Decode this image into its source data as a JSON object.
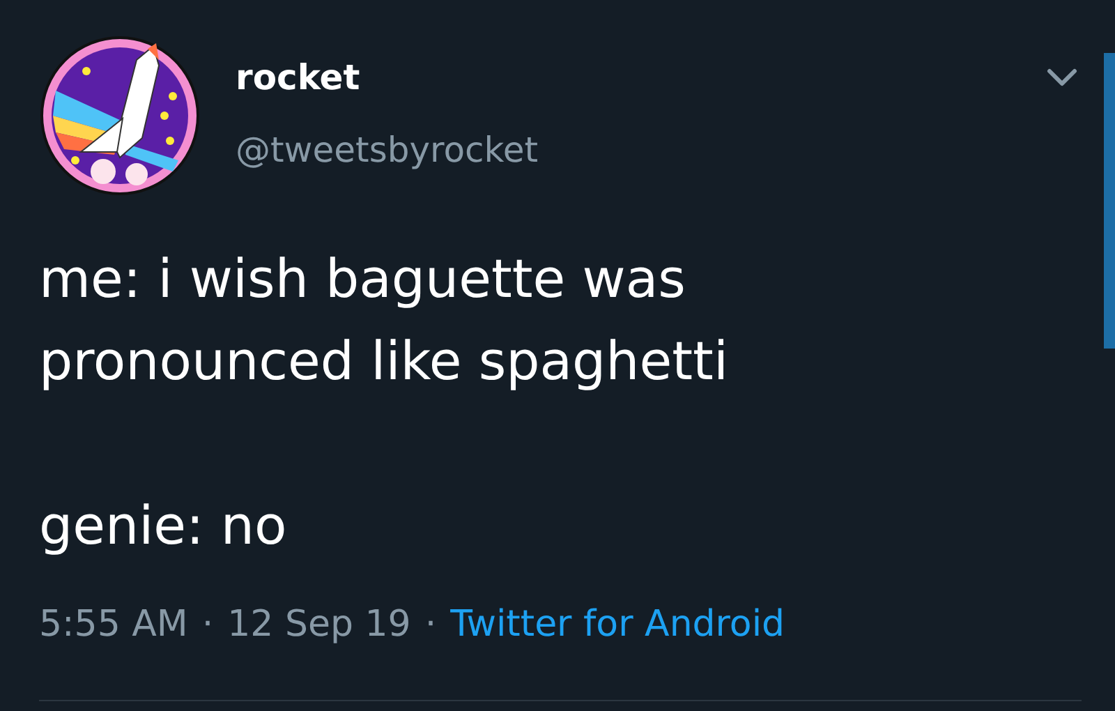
{
  "tweet": {
    "name": "rocket",
    "handle": "@tweetsbyrocket",
    "text": "me: i wish baguette was pronounced like spaghetti\n\ngenie: no",
    "meta": [
      {
        "kind": "time",
        "text": "5:55 AM"
      },
      {
        "kind": "separator",
        "text": "·"
      },
      {
        "kind": "date",
        "text": "12 Sep 19"
      },
      {
        "kind": "separator",
        "text": "·"
      },
      {
        "kind": "source",
        "text": "Twitter for Android"
      }
    ]
  }
}
